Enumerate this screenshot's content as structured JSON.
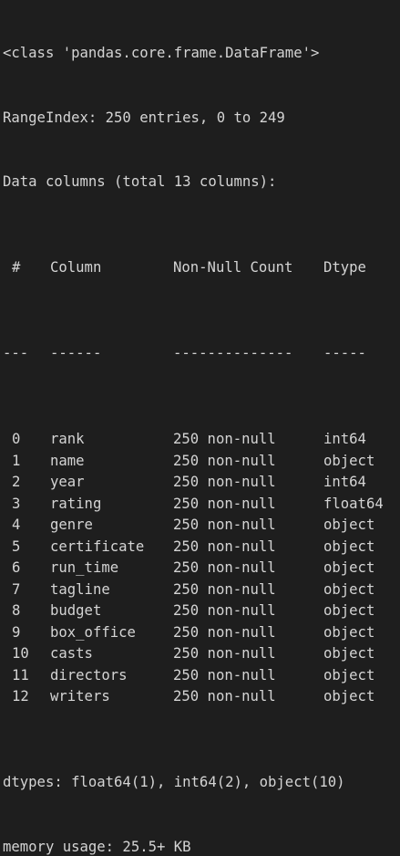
{
  "header": {
    "class_line": "<class 'pandas.core.frame.DataFrame'>",
    "range_index": "RangeIndex: 250 entries, 0 to 249",
    "data_columns": "Data columns (total 13 columns):"
  },
  "table": {
    "headers": {
      "index": "#",
      "column": "Column",
      "non_null": "Non-Null Count",
      "dtype": "Dtype"
    },
    "separators": {
      "index": "---",
      "column": "------",
      "non_null": "--------------",
      "dtype": "-----"
    },
    "rows": [
      {
        "index": "0",
        "column": "rank",
        "non_null": "250 non-null",
        "dtype": "int64"
      },
      {
        "index": "1",
        "column": "name",
        "non_null": "250 non-null",
        "dtype": "object"
      },
      {
        "index": "2",
        "column": "year",
        "non_null": "250 non-null",
        "dtype": "int64"
      },
      {
        "index": "3",
        "column": "rating",
        "non_null": "250 non-null",
        "dtype": "float64"
      },
      {
        "index": "4",
        "column": "genre",
        "non_null": "250 non-null",
        "dtype": "object"
      },
      {
        "index": "5",
        "column": "certificate",
        "non_null": "250 non-null",
        "dtype": "object"
      },
      {
        "index": "6",
        "column": "run_time",
        "non_null": "250 non-null",
        "dtype": "object"
      },
      {
        "index": "7",
        "column": "tagline",
        "non_null": "250 non-null",
        "dtype": "object"
      },
      {
        "index": "8",
        "column": "budget",
        "non_null": "250 non-null",
        "dtype": "object"
      },
      {
        "index": "9",
        "column": "box_office",
        "non_null": "250 non-null",
        "dtype": "object"
      },
      {
        "index": "10",
        "column": "casts",
        "non_null": "250 non-null",
        "dtype": "object"
      },
      {
        "index": "11",
        "column": "directors",
        "non_null": "250 non-null",
        "dtype": "object"
      },
      {
        "index": "12",
        "column": "writers",
        "non_null": "250 non-null",
        "dtype": "object"
      }
    ]
  },
  "footer": {
    "dtypes": "dtypes: float64(1), int64(2), object(10)",
    "memory": "memory usage: 25.5+ KB"
  },
  "colors": {
    "background": "#1e1e1e",
    "text": "#d4d4d4"
  }
}
